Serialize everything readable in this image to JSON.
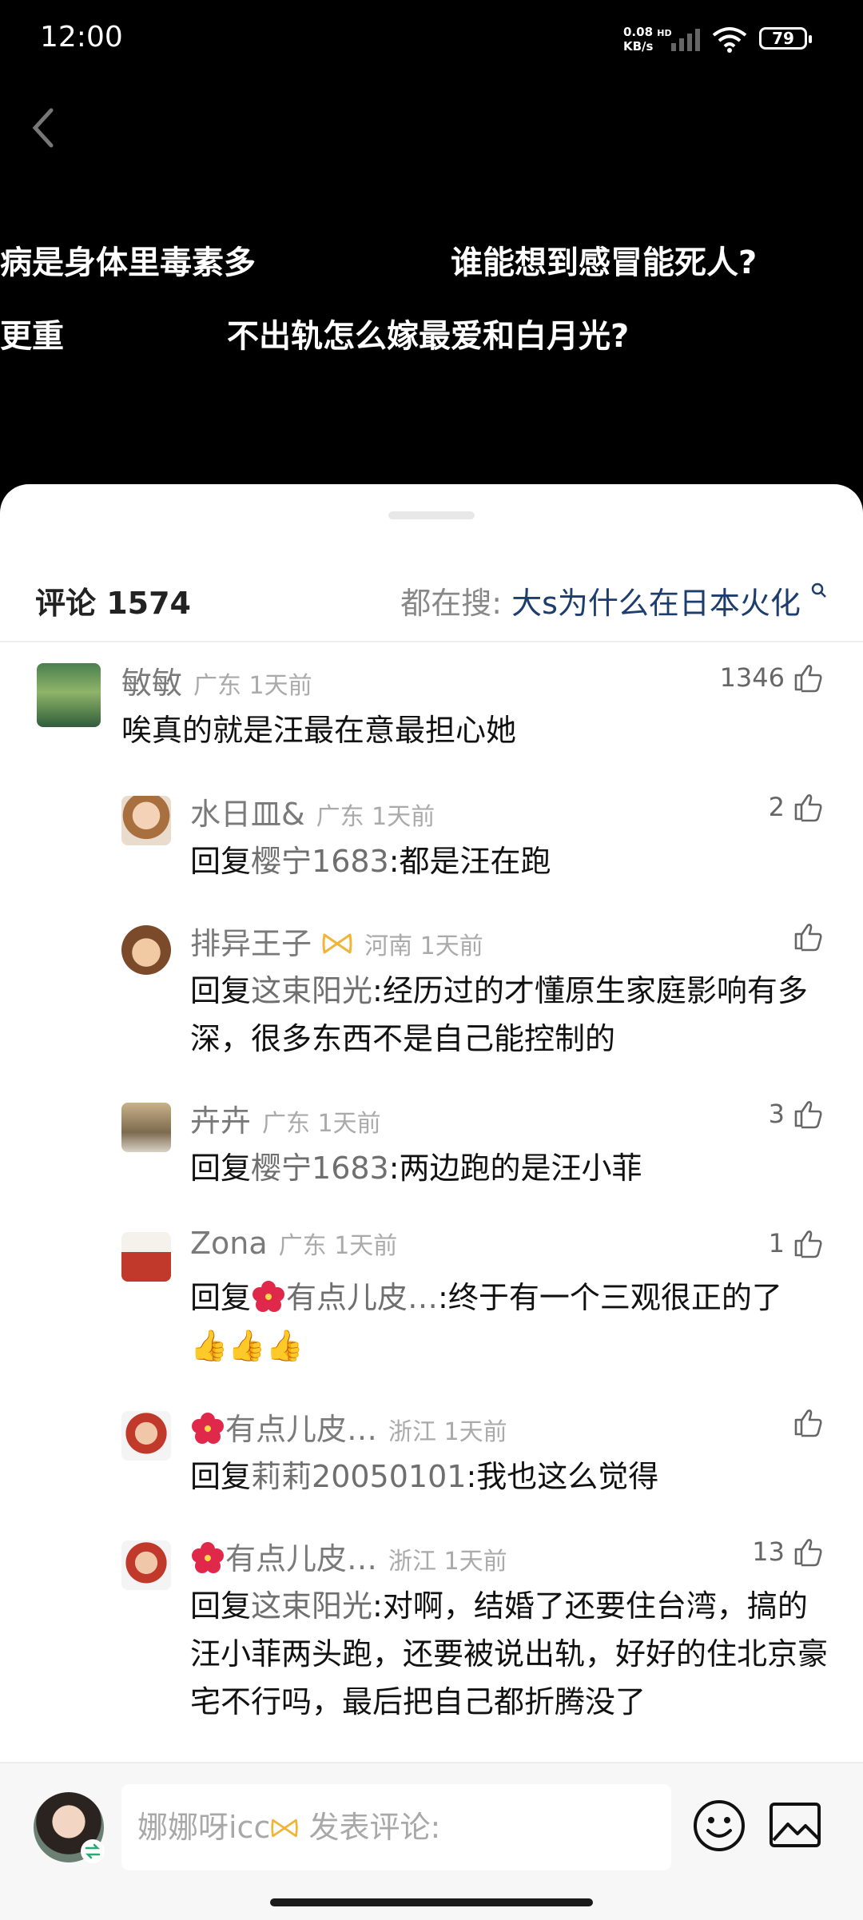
{
  "status_bar": {
    "time": "12:00",
    "net_speed": "0.08",
    "net_unit": "KB/s",
    "net_type": "HD",
    "battery": "79",
    "signal_sub": "6"
  },
  "danmaku": [
    "病是身体里毒素多",
    "谁能想到感冒能死人?",
    "更重",
    "不出轨怎么嫁最爱和白月光?"
  ],
  "header": {
    "title": "评论 1574",
    "search_prefix": "都在搜:",
    "search_keyword": "大s为什么在日本火化"
  },
  "comments": [
    {
      "name": "敏敏",
      "meta": "广东 1天前",
      "likes": "1346",
      "text": "唉真的就是汪最在意最担心她",
      "reply_to": "",
      "tail": ""
    },
    {
      "name": "水日皿&",
      "meta": "广东 1天前",
      "likes": "2",
      "reply_prefix": "回复",
      "reply_to": "樱宁1683",
      "text": ":都是汪在跑"
    },
    {
      "name": "排异王子",
      "meta": "河南 1天前",
      "likes": "",
      "reply_prefix": "回复",
      "reply_to": "这束阳光",
      "text": ":经历过的才懂原生家庭影响有多深，很多东西不是自己能控制的"
    },
    {
      "name": "卉卉",
      "meta": "广东 1天前",
      "likes": "3",
      "reply_prefix": "回复",
      "reply_to": "樱宁1683",
      "text": ":两边跑的是汪小菲"
    },
    {
      "name": "Zona",
      "meta": "广东 1天前",
      "likes": "1",
      "reply_prefix": "回复",
      "reply_to": "有点儿皮…",
      "text": ":终于有一个三观很正的了",
      "tail": "👍👍👍"
    },
    {
      "name": "有点儿皮…",
      "meta": "浙江 1天前",
      "likes": "",
      "reply_prefix": "回复",
      "reply_to": "莉莉20050101",
      "text": ":我也这么觉得"
    },
    {
      "name": "有点儿皮…",
      "meta": "浙江 1天前",
      "likes": "13",
      "reply_prefix": "回复",
      "reply_to": "这束阳光",
      "text": ":对啊，结婚了还要住台湾，搞的汪小菲两头跑，还要被说出轨，好好的住北京豪宅不行吗，最后把自己都折腾没了"
    }
  ],
  "composer": {
    "user": "娜娜呀icc",
    "placeholder": "发表评论:"
  },
  "colors": {
    "accent": "#1c3d6e",
    "flower": "#e0284a",
    "bow": "#f2b437"
  }
}
